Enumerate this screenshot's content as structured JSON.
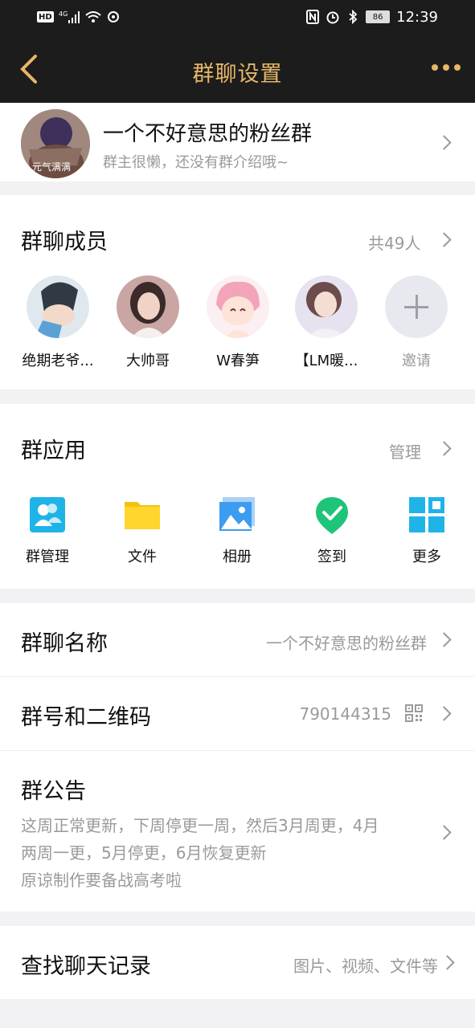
{
  "status_bar": {
    "left_icons": [
      "hd-icon",
      "4g-signal-icon",
      "wifi-icon",
      "sync-icon"
    ],
    "hd_label": "HD",
    "network_label": "4G",
    "right_icons": [
      "nfc-icon",
      "alarm-icon",
      "bluetooth-icon",
      "battery-icon"
    ],
    "battery": "86",
    "time": "12:39"
  },
  "header": {
    "title": "群聊设置",
    "accent_color": "#e6b766",
    "background": "#1c1c1c"
  },
  "group": {
    "name": "一个不好意思的粉丝群",
    "description": "群主很懒，还没有群介绍哦~",
    "avatar_caption": "元气满满"
  },
  "members": {
    "title": "群聊成员",
    "count_label": "共49人",
    "list": [
      {
        "name": "绝期老爷..."
      },
      {
        "name": "大帅哥"
      },
      {
        "name": "W春笋"
      },
      {
        "name": "【LM暖..."
      },
      {
        "name": "邀请"
      }
    ]
  },
  "apps": {
    "title": "群应用",
    "manage_label": "管理",
    "items": [
      {
        "label": "群管理",
        "icon": "group-manage-icon"
      },
      {
        "label": "文件",
        "icon": "folder-icon"
      },
      {
        "label": "相册",
        "icon": "album-icon"
      },
      {
        "label": "签到",
        "icon": "check-in-icon"
      },
      {
        "label": "更多",
        "icon": "grid-more-icon"
      }
    ]
  },
  "settings": {
    "group_name_label": "群聊名称",
    "group_name_value": "一个不好意思的粉丝群",
    "group_id_label": "群号和二维码",
    "group_id_value": "790144315",
    "notice_label": "群公告",
    "notice_lines": [
      "这周正常更新，下周停更一周，然后3月周更，4月",
      "两周一更，5月停更，6月恢复更新",
      "原谅制作要备战高考啦"
    ],
    "search_label": "查找聊天记录",
    "search_value": "图片、视频、文件等"
  }
}
